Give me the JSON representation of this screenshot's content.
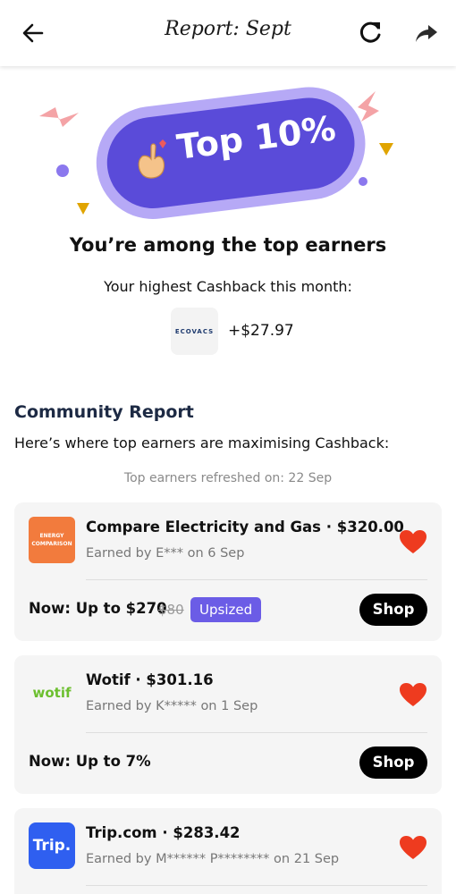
{
  "header": {
    "title": "Report: Sept",
    "back_icon": "arrow-left-icon",
    "refresh_icon": "refresh-icon",
    "share_icon": "share-arrow-icon"
  },
  "hero": {
    "badge_text": "Top 10%",
    "badge_icon": "finger-heart-hand-icon",
    "headline": "You’re among the top earners",
    "subline": "Your highest Cashback this month:",
    "highest": {
      "merchant_logo_text": "ECOVACS",
      "amount": "+$27.97"
    },
    "colors": {
      "pill_outer": "#b6a9f6",
      "pill_inner": "#5a4bd9",
      "accent_yellow": "#e0a400",
      "accent_pink": "#f4a3a6",
      "accent_purple": "#8b78ee"
    }
  },
  "community": {
    "title": "Community Report",
    "description": "Here’s where top earners are maximising Cashback:",
    "refreshed": "Top earners refreshed on: 22 Sep",
    "cards": [
      {
        "merchant": "Compare Electricity and Gas · $320.00",
        "earned": "Earned by E*** on 6 Sep",
        "offer": "Now: Up to $270",
        "old_rate": "$80",
        "badge": "Upsized",
        "shop_label": "Shop",
        "logo_text_1": "ENERGY",
        "logo_text_2": "COMPARISON",
        "logo_color": "#f27b3d"
      },
      {
        "merchant": "Wotif · $301.16",
        "earned": "Earned by K***** on 1 Sep",
        "offer": "Now: Up to 7%",
        "shop_label": "Shop",
        "logo_text": "wotif",
        "logo_color": "#6cbf2f"
      },
      {
        "merchant": "Trip.com · $283.42",
        "earned": "Earned by M****** P******** on 21 Sep",
        "logo_text": "Trip.",
        "logo_color": "#2f5ff0"
      }
    ],
    "heart_color": "#ee3b1f"
  }
}
